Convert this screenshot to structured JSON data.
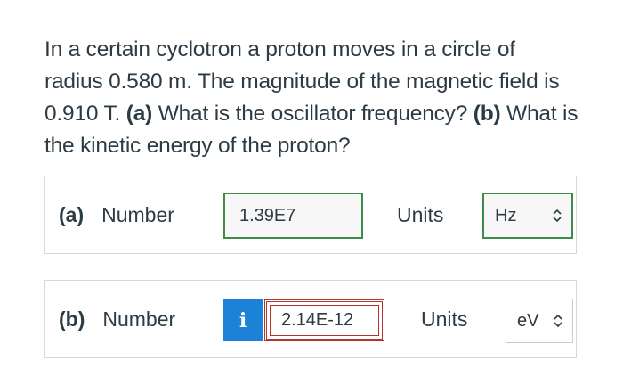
{
  "problem": {
    "text_1": "In a certain cyclotron a proton moves in a circle of radius 0.580 m. The magnitude of the magnetic field is 0.910 T. ",
    "part_a_tag": "(a)",
    "part_a_question": " What is the oscillator frequency? ",
    "part_b_tag": "(b)",
    "part_b_question": " What is the kinetic energy of the proton?"
  },
  "answers": [
    {
      "part": "(a)",
      "label": "Number",
      "value": "1.39E7",
      "units_label": "Units",
      "units": "Hz",
      "status": "correct",
      "status_color": "#3f8c4a"
    },
    {
      "part": "(b)",
      "label": "Number",
      "info_icon": "i",
      "value": "2.14E-12",
      "units_label": "Units",
      "units": "eV",
      "status": "incorrect",
      "status_color": "#b4332e"
    }
  ],
  "colors": {
    "text": "#2d3b45",
    "info_button": "#1b82d8",
    "correct_border": "#3f8c4a",
    "incorrect_border": "#b4332e"
  }
}
